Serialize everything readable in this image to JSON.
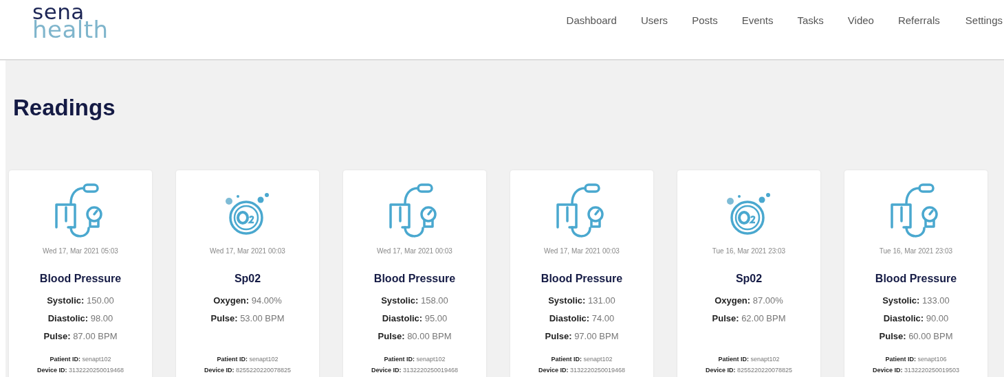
{
  "logo": {
    "top": "sena",
    "bottom": "health"
  },
  "nav": [
    {
      "label": "Dashboard"
    },
    {
      "label": "Users"
    },
    {
      "label": "Posts"
    },
    {
      "label": "Events"
    },
    {
      "label": "Tasks"
    },
    {
      "label": "Video"
    },
    {
      "label": "Referrals"
    },
    {
      "label": "Settings"
    }
  ],
  "page_title": "Readings",
  "readings": [
    {
      "kind": "blood_pressure",
      "date": "Wed 17, Mar 2021 05:03",
      "title": "Blood Pressure",
      "fields": [
        {
          "label": "Systolic:",
          "value": "150.00"
        },
        {
          "label": "Diastolic:",
          "value": "98.00"
        },
        {
          "label": "Pulse:",
          "value": "87.00 BPM"
        }
      ],
      "patient_label": "Patient ID:",
      "patient_id": "senapt102",
      "device_label": "Device ID:",
      "device_id": "3132220250019468"
    },
    {
      "kind": "spo2",
      "date": "Wed 17, Mar 2021 00:03",
      "title": "Sp02",
      "fields": [
        {
          "label": "Oxygen:",
          "value": "94.00%"
        },
        {
          "label": "Pulse:",
          "value": "53.00 BPM"
        }
      ],
      "patient_label": "Patient ID:",
      "patient_id": "senapt102",
      "device_label": "Device ID:",
      "device_id": "8255220220078825"
    },
    {
      "kind": "blood_pressure",
      "date": "Wed 17, Mar 2021 00:03",
      "title": "Blood Pressure",
      "fields": [
        {
          "label": "Systolic:",
          "value": "158.00"
        },
        {
          "label": "Diastolic:",
          "value": "95.00"
        },
        {
          "label": "Pulse:",
          "value": "80.00 BPM"
        }
      ],
      "patient_label": "Patient ID:",
      "patient_id": "senapt102",
      "device_label": "Device ID:",
      "device_id": "3132220250019468"
    },
    {
      "kind": "blood_pressure",
      "date": "Wed 17, Mar 2021 00:03",
      "title": "Blood Pressure",
      "fields": [
        {
          "label": "Systolic:",
          "value": "131.00"
        },
        {
          "label": "Diastolic:",
          "value": "74.00"
        },
        {
          "label": "Pulse:",
          "value": "97.00 BPM"
        }
      ],
      "patient_label": "Patient ID:",
      "patient_id": "senapt102",
      "device_label": "Device ID:",
      "device_id": "3132220250019468"
    },
    {
      "kind": "spo2",
      "date": "Tue 16, Mar 2021 23:03",
      "title": "Sp02",
      "fields": [
        {
          "label": "Oxygen:",
          "value": "87.00%"
        },
        {
          "label": "Pulse:",
          "value": "62.00 BPM"
        }
      ],
      "patient_label": "Patient ID:",
      "patient_id": "senapt102",
      "device_label": "Device ID:",
      "device_id": "8255220220078825"
    },
    {
      "kind": "blood_pressure",
      "date": "Tue 16, Mar 2021 23:03",
      "title": "Blood Pressure",
      "fields": [
        {
          "label": "Systolic:",
          "value": "133.00"
        },
        {
          "label": "Diastolic:",
          "value": "90.00"
        },
        {
          "label": "Pulse:",
          "value": "60.00 BPM"
        }
      ],
      "patient_label": "Patient ID:",
      "patient_id": "senapt106",
      "device_label": "Device ID:",
      "device_id": "3132220250019503"
    }
  ]
}
